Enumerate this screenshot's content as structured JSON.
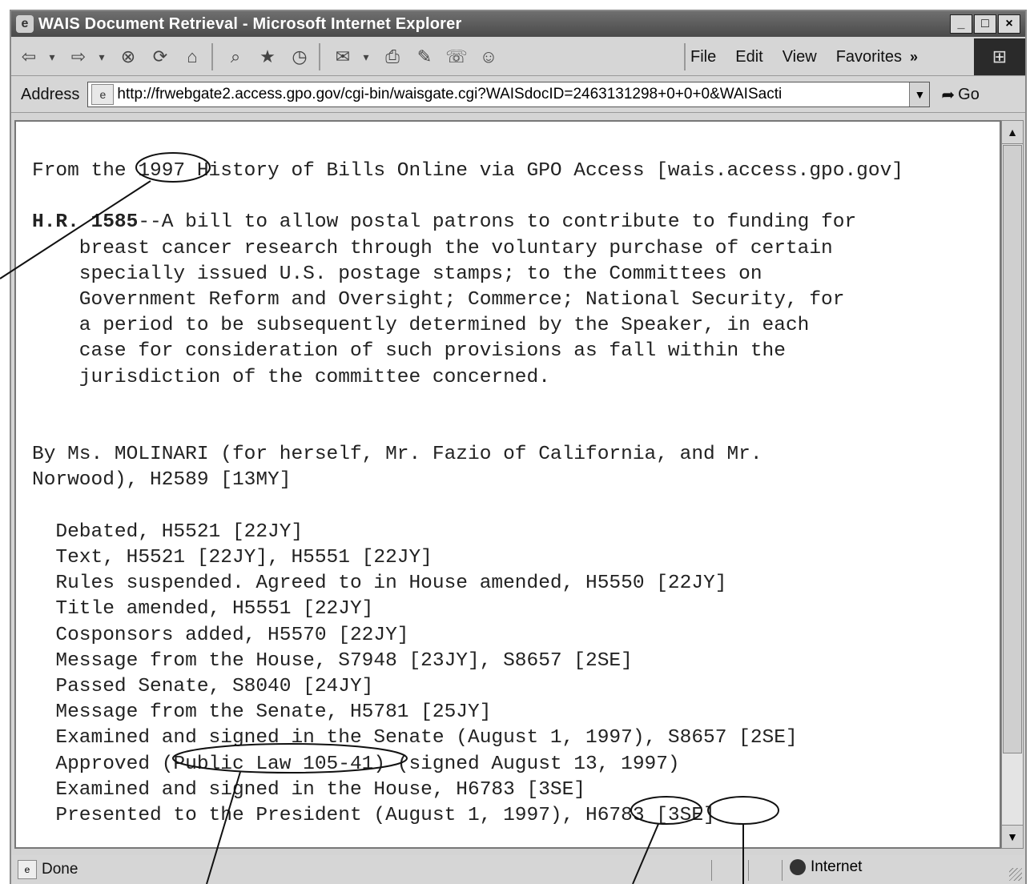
{
  "window": {
    "title": "WAIS Document Retrieval - Microsoft Internet Explorer",
    "controls": [
      "_",
      "□",
      "×"
    ]
  },
  "toolbar": {
    "icons": [
      "back-icon",
      "forward-icon",
      "stop-icon",
      "refresh-icon",
      "home-icon",
      "search-icon",
      "favorites-icon",
      "history-icon",
      "mail-icon",
      "print-icon",
      "edit-icon",
      "discuss-icon",
      "messenger-icon"
    ]
  },
  "menu": {
    "file": "File",
    "edit": "Edit",
    "view": "View",
    "favorites": "Favorites",
    "more": "»"
  },
  "address": {
    "label": "Address",
    "url": "http://frwebgate2.access.gpo.gov/cgi-bin/waisgate.cgi?WAISdocID=2463131298+0+0+0&WAISacti",
    "go": "Go"
  },
  "document": {
    "source_line": "From the 1997 History of Bills Online via GPO Access [wais.access.gpo.gov]",
    "bill_number": "H.R. 1585",
    "bill_description": "--A bill to allow postal patrons to contribute to funding for\n    breast cancer research through the voluntary purchase of certain\n    specially issued U.S. postage stamps; to the Committees on\n    Government Reform and Oversight; Commerce; National Security, for\n    a period to be subsequently determined by the Speaker, in each\n    case for consideration of such provisions as fall within the\n    jurisdiction of the committee concerned.",
    "sponsor": "By Ms. MOLINARI (for herself, Mr. Fazio of California, and Mr.\nNorwood), H2589 [13MY]",
    "actions": [
      "Debated, H5521 [22JY]",
      "Text, H5521 [22JY], H5551 [22JY]",
      "Rules suspended. Agreed to in House amended, H5550 [22JY]",
      "Title amended, H5551 [22JY]",
      "Cosponsors added, H5570 [22JY]",
      "Message from the House, S7948 [23JY], S8657 [2SE]",
      "Passed Senate, S8040 [24JY]",
      "Message from the Senate, H5781 [25JY]",
      "Examined and signed in the Senate (August 1, 1997), S8657 [2SE]",
      "Approved (Public Law 105-41) (signed August 13, 1997)",
      "Examined and signed in the House, H6783 [3SE]",
      "Presented to the President (August 1, 1997), H6783 [3SE]"
    ]
  },
  "status": {
    "text": "Done",
    "zone": "Internet"
  }
}
